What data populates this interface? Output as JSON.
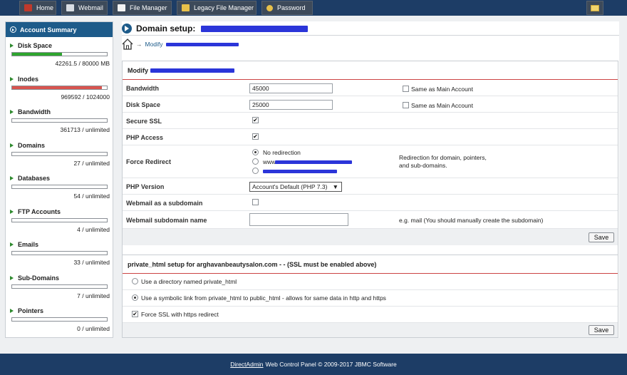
{
  "nav": {
    "tabs": [
      {
        "label": "Home",
        "icon": "home-icon"
      },
      {
        "label": "Webmail",
        "icon": "mail-icon"
      },
      {
        "label": "File Manager",
        "icon": "file-manager-icon"
      },
      {
        "label": "Legacy File Manager",
        "icon": "folder-icon"
      },
      {
        "label": "Password",
        "icon": "key-icon"
      }
    ],
    "mail_icon": "envelope-icon"
  },
  "sidebar": {
    "title": "Account Summary",
    "stats": [
      {
        "label": "Disk Space",
        "value": "42261.5 / 80000 MB",
        "fill": 0.53,
        "color": "#2ea52e"
      },
      {
        "label": "Inodes",
        "value": "969592 / 1024000",
        "fill": 0.95,
        "color": "#d9544f"
      },
      {
        "label": "Bandwidth",
        "value": "361713 / unlimited",
        "fill": 0,
        "color": "#2ea52e"
      },
      {
        "label": "Domains",
        "value": "27 / unlimited",
        "fill": 0,
        "color": "#2ea52e"
      },
      {
        "label": "Databases",
        "value": "54 / unlimited",
        "fill": 0,
        "color": "#2ea52e"
      },
      {
        "label": "FTP Accounts",
        "value": "4 / unlimited",
        "fill": 0,
        "color": "#2ea52e"
      },
      {
        "label": "Emails",
        "value": "33 / unlimited",
        "fill": 0,
        "color": "#2ea52e"
      },
      {
        "label": "Sub-Domains",
        "value": "7 / unlimited",
        "fill": 0,
        "color": "#2ea52e"
      },
      {
        "label": "Pointers",
        "value": "0 / unlimited",
        "fill": 0,
        "color": "#2ea52e"
      }
    ]
  },
  "main": {
    "title": "Domain setup:",
    "breadcrumb": {
      "arrow": "→",
      "link": "Modify"
    },
    "modify": {
      "heading": "Modify",
      "bandwidth": {
        "label": "Bandwidth",
        "value": "45000",
        "same_label": "Same as Main Account",
        "same_checked": false
      },
      "disk_space": {
        "label": "Disk Space",
        "value": "25000",
        "same_label": "Same as Main Account",
        "same_checked": false
      },
      "secure_ssl": {
        "label": "Secure SSL",
        "checked": true
      },
      "php_access": {
        "label": "PHP Access",
        "checked": true
      },
      "force_redirect": {
        "label": "Force Redirect",
        "options": [
          "No redirection",
          "www"
        ],
        "selected": 0,
        "note_line1": "Redirection for domain, pointers,",
        "note_line2": "and sub-domains."
      },
      "php_version": {
        "label": "PHP Version",
        "selected": "Account's Default (PHP 7.3)",
        "arrow": "▼"
      },
      "webmail_subdomain": {
        "label": "Webmail as a subdomain",
        "checked": false
      },
      "webmail_name": {
        "label": "Webmail subdomain name",
        "value": "",
        "hint": "e.g. mail (You should manually create the subdomain)"
      },
      "save_label": "Save"
    },
    "private_html": {
      "heading": "private_html setup for arghavanbeautysalon.com - - (SSL must be enabled above)",
      "options": [
        "Use a directory named private_html",
        "Use a symbolic link from private_html to public_html - allows for same data in http and https"
      ],
      "selected": 1,
      "force_ssl": {
        "label": "Force SSL with https redirect",
        "checked": true
      },
      "save_label": "Save"
    }
  },
  "footer": {
    "link": "DirectAdmin",
    "text": "Web Control Panel © 2009-2017 JBMC Software"
  },
  "colors": {
    "nav_bg": "#1d3d66",
    "accent": "#1d5b8a",
    "redaction": "#2b35d9",
    "disk_bar": "#2ea52e",
    "inode_bar": "#d9544f"
  }
}
